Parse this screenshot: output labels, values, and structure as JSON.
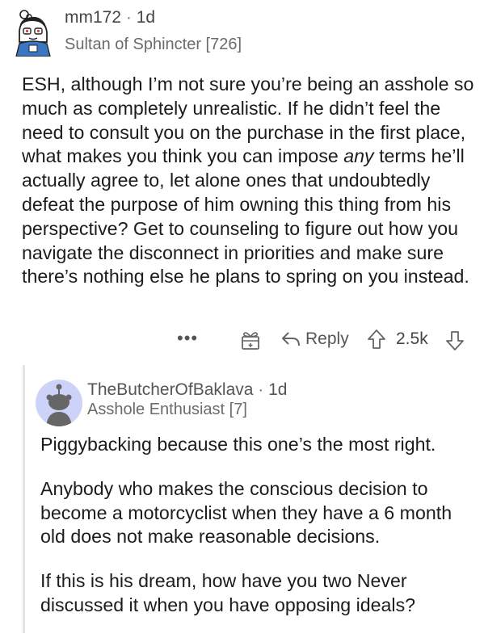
{
  "comment1": {
    "username": "mm172",
    "separator": "·",
    "age": "1d",
    "flair": "Sultan of Sphincter [726]",
    "text_before_em": "ESH, although I’m not sure you’re being an asshole so much as completely unrealistic.  If he didn’t feel the need to consult you on the purchase in the first place, what makes you think you can impose ",
    "text_em": "any",
    "text_after_em": " terms he’ll actually agree to, let alone ones that undoubtedly defeat the purpose of him owning this thing from his perspective?  Get to counseling to figure out how you navigate the disconnect in priorities and make sure there’s nothing else he plans to spring on you instead."
  },
  "actions": {
    "more_label": "•••",
    "award_icon": "gift-icon",
    "reply_label": "Reply",
    "score": "2.5k"
  },
  "comment2": {
    "username": "TheButcherOfBaklava",
    "separator": "·",
    "age": "1d",
    "flair": "Asshole Enthusiast [7]",
    "paragraphs": [
      "Piggybacking because this one’s the most right.",
      "Anybody who makes the conscious decision to become a motorcyclist when they have a 6 month old does not make reasonable decisions.",
      "If this is his dream, how have you two Never discussed it when you have opposing ideals?"
    ]
  },
  "colors": {
    "avatar2_bg": "#cdd2f8",
    "thread_line": "#e4e4e4",
    "text": "#1c1c1c",
    "meta": "#6b6b6b"
  }
}
